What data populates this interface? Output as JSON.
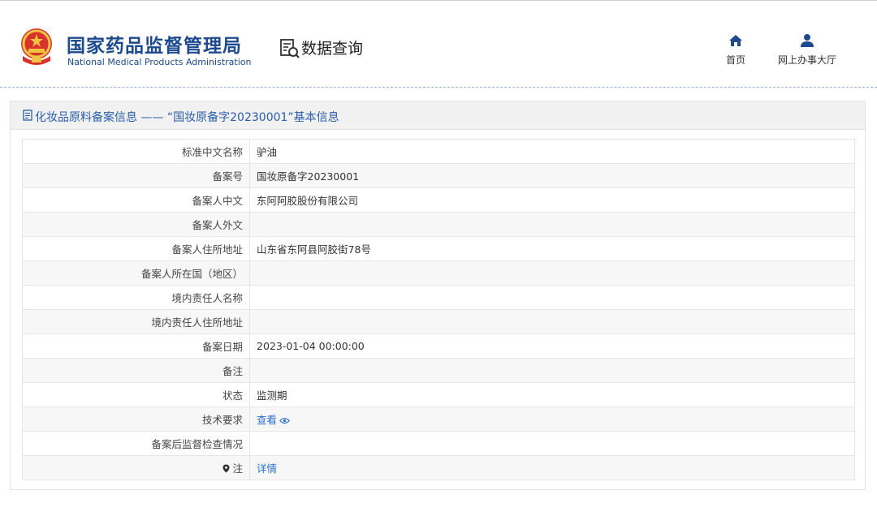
{
  "header": {
    "brand_cn": "国家药品监督管理局",
    "brand_en": "National Medical Products Administration",
    "query_label": "数据查询",
    "nav": [
      {
        "label": "首页",
        "icon": "home-icon"
      },
      {
        "label": "网上办事大厅",
        "icon": "user-icon"
      }
    ]
  },
  "panel": {
    "title": "化妆品原料备案信息 —— “国妆原备字20230001”基本信息",
    "rows": [
      {
        "label": "标准中文名称",
        "value": "驴油"
      },
      {
        "label": "备案号",
        "value": "国妆原备字20230001"
      },
      {
        "label": "备案人中文",
        "value": "东阿阿胶股份有限公司"
      },
      {
        "label": "备案人外文",
        "value": ""
      },
      {
        "label": "备案人住所地址",
        "value": "山东省东阿县阿胶街78号"
      },
      {
        "label": "备案人所在国（地区）",
        "value": ""
      },
      {
        "label": "境内责任人名称",
        "value": ""
      },
      {
        "label": "境内责任人住所地址",
        "value": ""
      },
      {
        "label": "备案日期",
        "value": "2023-01-04 00:00:00"
      },
      {
        "label": "备注",
        "value": ""
      },
      {
        "label": "状态",
        "value": "监测期"
      },
      {
        "label": "技术要求",
        "value": "查看"
      },
      {
        "label": "备案后监督检查情况",
        "value": ""
      },
      {
        "label": "注",
        "value": "详情"
      }
    ]
  },
  "colors": {
    "brand": "#1c4a8c",
    "link": "#2a6fc9",
    "title": "#2a5ca8"
  }
}
